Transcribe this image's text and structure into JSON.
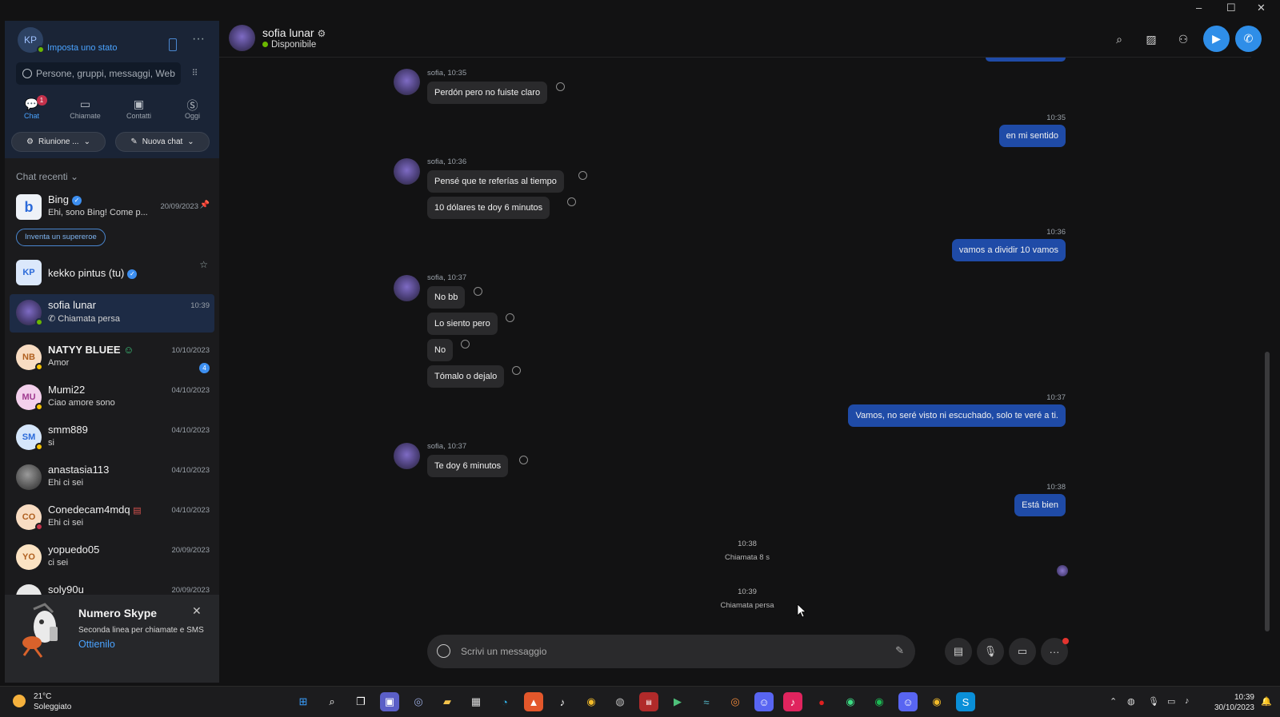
{
  "titlebar": {
    "minimize": "–",
    "maximize": "☐",
    "close": "✕"
  },
  "profile": {
    "initials": "KP",
    "status_link": "Imposta uno stato",
    "more": "···"
  },
  "search": {
    "placeholder": "Persone, gruppi, messaggi, Web",
    "dialpad": "⠿"
  },
  "nav": [
    {
      "label": "Chat",
      "badge": "1"
    },
    {
      "label": "Chiamate"
    },
    {
      "label": "Contatti"
    },
    {
      "label": "Oggi"
    }
  ],
  "buttons": {
    "meeting": "Riunione ...",
    "new_chat": "Nuova chat"
  },
  "recent_header": "Chat recenti",
  "chats": [
    {
      "name": "Bing",
      "preview": "Ehi, sono Bing! Come p...",
      "date": "20/09/2023",
      "suggestion": "Inventa un supereroe"
    },
    {
      "name": "kekko pintus (tu)",
      "initials": "KP",
      "preview": "",
      "date": ""
    },
    {
      "name": "sofia lunar",
      "preview": "Chiamata persa",
      "date": "10:39"
    },
    {
      "name": "NATYY BLUEE",
      "initials": "NB",
      "preview": "Amor",
      "date": "10/10/2023",
      "unread": "4"
    },
    {
      "name": "Mumi22",
      "initials": "MU",
      "preview": "Ciao amore sono",
      "date": "04/10/2023"
    },
    {
      "name": "smm889",
      "initials": "SM",
      "preview": "si",
      "date": "04/10/2023"
    },
    {
      "name": "anastasia113",
      "preview": "Ehi ci sei",
      "date": "04/10/2023"
    },
    {
      "name": "Conedecam4mdq",
      "initials": "CO",
      "preview": "Ehi ci sei",
      "date": "04/10/2023"
    },
    {
      "name": "yopuedo05",
      "initials": "YO",
      "preview": "ci sei",
      "date": "20/09/2023"
    },
    {
      "name": "soly90u",
      "initials": "",
      "preview": "",
      "date": "20/09/2023"
    }
  ],
  "promo": {
    "title": "Numero Skype",
    "subtitle": "Seconda linea per chiamate e SMS",
    "link": "Ottienilo",
    "close": "✕"
  },
  "header": {
    "name": "sofia lunar",
    "status": "Disponibile"
  },
  "messages": {
    "in1_meta": "sofia, 10:35",
    "in1_text": "Perdón pero no fuiste claro",
    "out1_time": "10:35",
    "out1_text": "en mi sentido",
    "in2_meta": "sofia, 10:36",
    "in2_text": "Pensé que te referías al tiempo",
    "in2b_text": "10 dólares te doy 6 minutos",
    "out2_time": "10:36",
    "out2_text": "vamos a dividir 10 vamos",
    "in3_meta": "sofia, 10:37",
    "in3_text": "No bb",
    "in3b_text": "Lo siento pero",
    "in3c_text": "No",
    "in3d_text": "Tómalo o dejalo",
    "out3_time": "10:37",
    "out3_text": "Vamos, no seré visto ni escuchado, solo te veré a ti.",
    "in4_meta": "sofia, 10:37",
    "in4_text": "Te doy 6 minutos",
    "out4_time": "10:38",
    "out4_text": "Está bien",
    "sys1_time": "10:38",
    "sys1_text": "Chiamata 8 s",
    "sys2_time": "10:39",
    "sys2_text": "Chiamata persa"
  },
  "compose": {
    "placeholder": "Scrivi un messaggio"
  },
  "taskbar": {
    "temp": "21°C",
    "weather": "Soleggiato",
    "time": "10:39",
    "date": "30/10/2023"
  }
}
